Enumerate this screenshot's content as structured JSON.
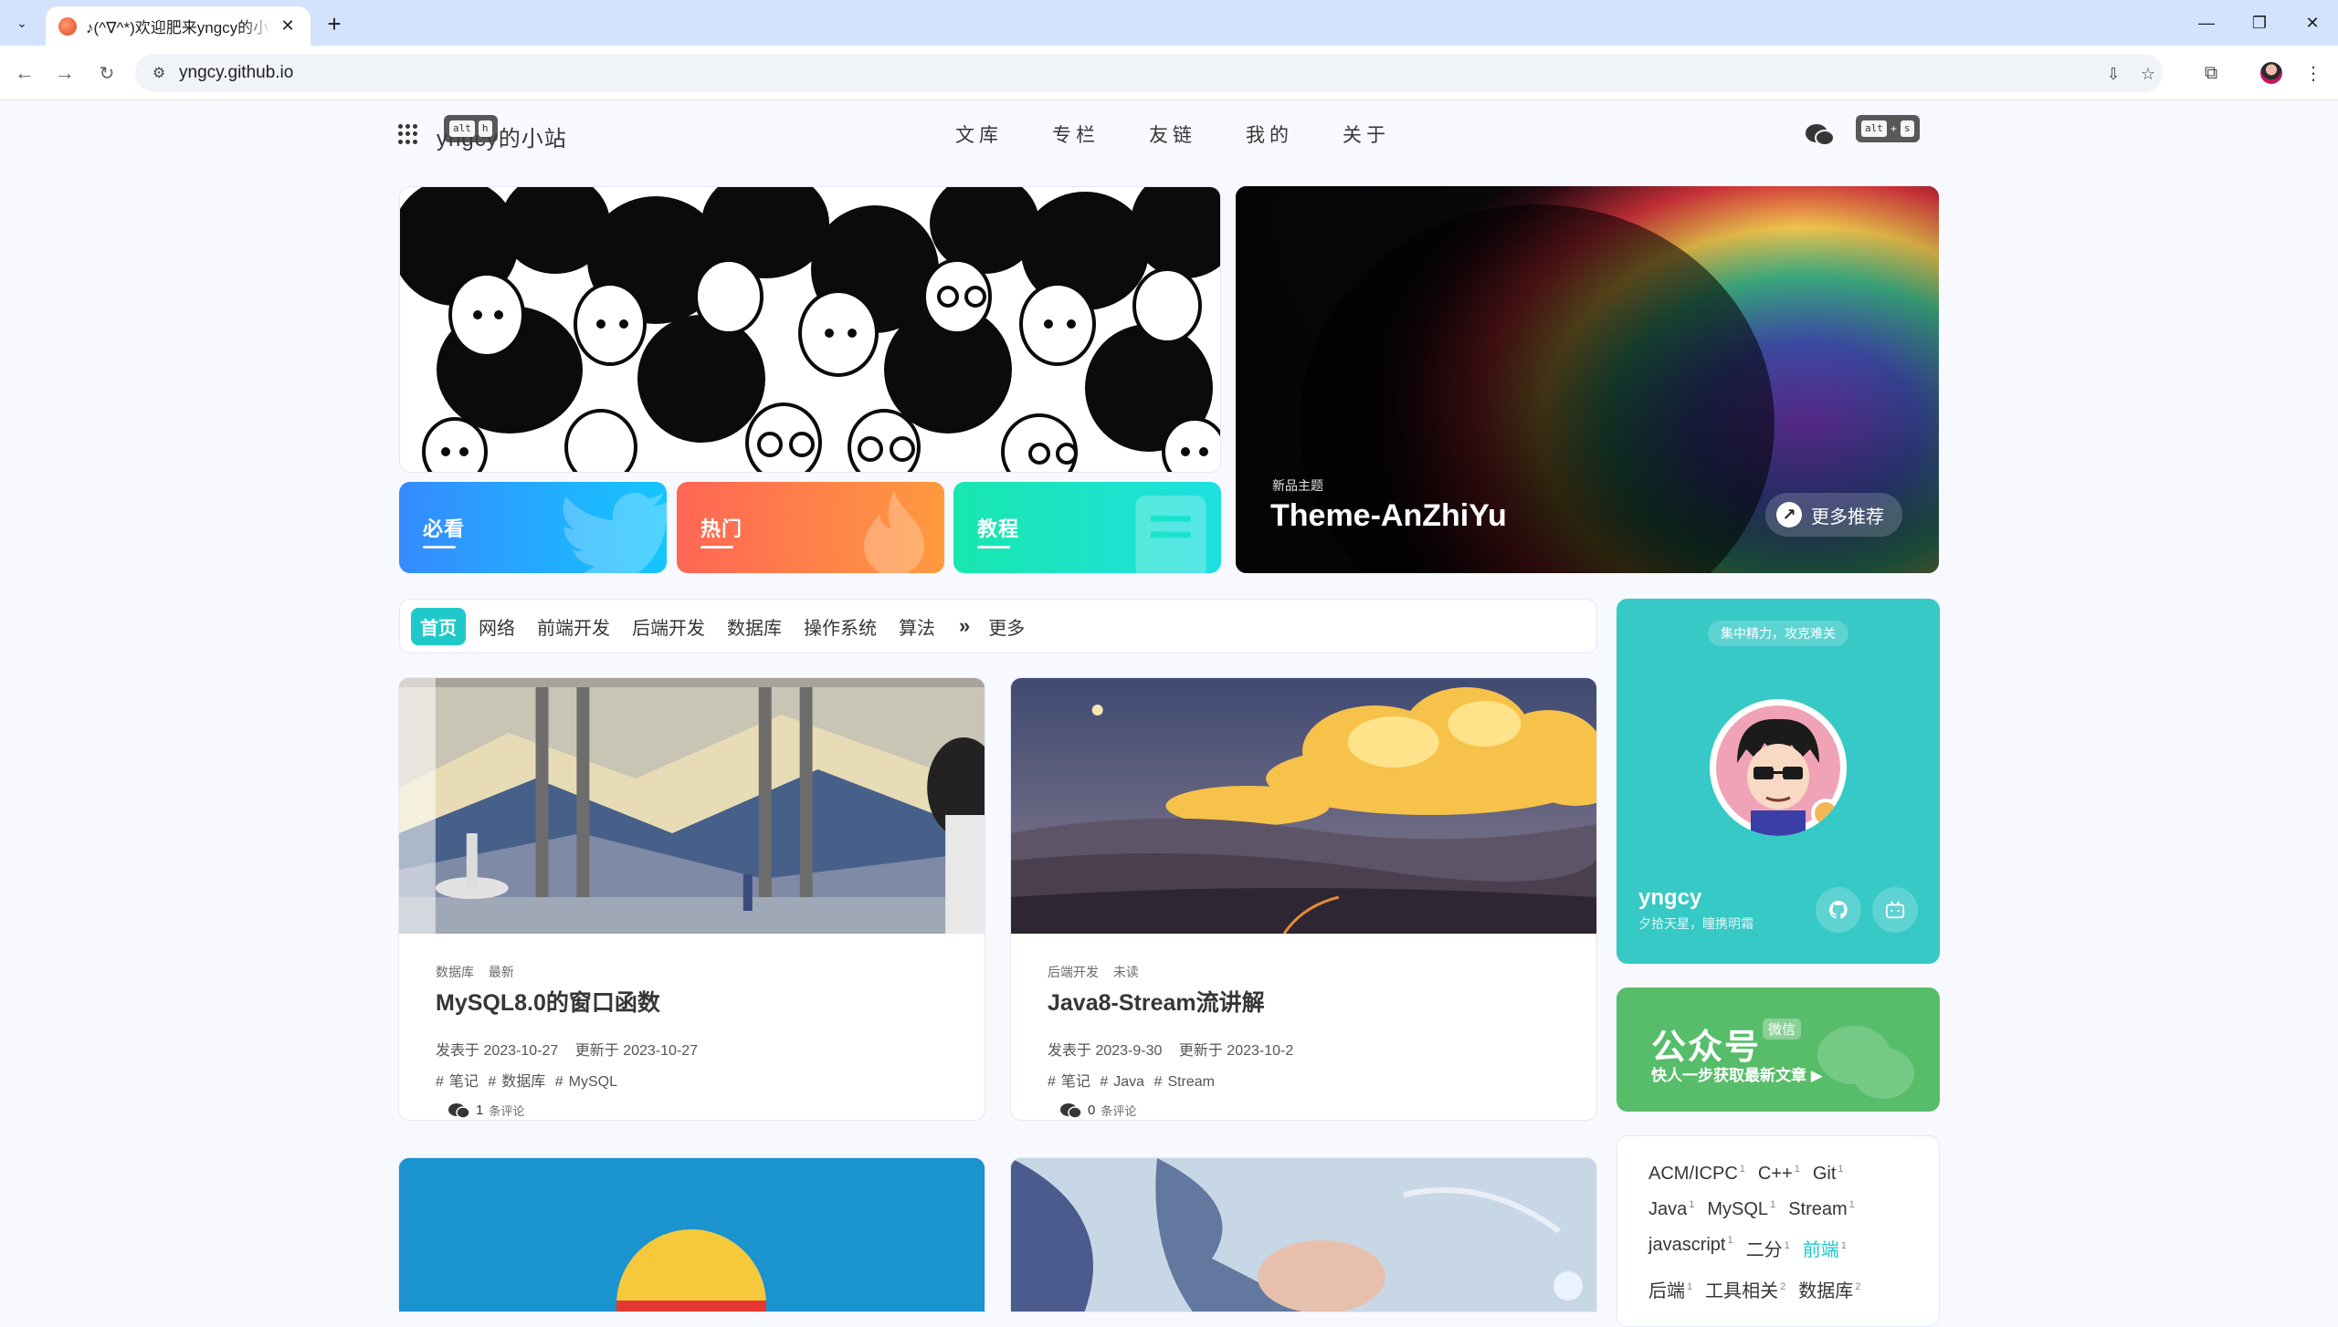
{
  "browser": {
    "tab_title": "♪(^∇^*)欢迎肥来yngcy的小站",
    "url": "yngcy.github.io"
  },
  "header": {
    "site_name": "yngcy的小站",
    "kbd_hint_left": [
      "alt",
      "h"
    ],
    "kbd_hint_right": [
      "alt",
      "+",
      "s"
    ],
    "nav": [
      "文库",
      "专栏",
      "友链",
      "我的",
      "关于"
    ]
  },
  "hero": {
    "categories": [
      {
        "label": "必看",
        "color_from": "#358bff",
        "color_to": "#15c6ff"
      },
      {
        "label": "热门",
        "color_from": "#f65",
        "color_to": "#ff9a3e"
      },
      {
        "label": "教程",
        "color_from": "#18e7ae",
        "color_to": "#1ee0e1"
      }
    ],
    "featured_tag": "新品主题",
    "featured_title": "Theme-AnZhiYu",
    "more_label": "更多推荐"
  },
  "category_bar": {
    "items": [
      "首页",
      "网络",
      "前端开发",
      "后端开发",
      "数据库",
      "操作系统",
      "算法"
    ],
    "active_index": 0,
    "more_label": "更多"
  },
  "posts": [
    {
      "categories": [
        "数据库",
        "最新"
      ],
      "title": "MySQL8.0的窗口函数",
      "published": "发表于 2023-10-27",
      "updated": "更新于 2023-10-27",
      "tags": [
        "笔记",
        "数据库",
        "MySQL"
      ],
      "comment_count": "1",
      "comment_suffix": "条评论"
    },
    {
      "categories": [
        "后端开发",
        "未读"
      ],
      "title": "Java8-Stream流讲解",
      "published": "发表于 2023-9-30",
      "updated": "更新于 2023-10-2",
      "tags": [
        "笔记",
        "Java",
        "Stream"
      ],
      "comment_count": "0",
      "comment_suffix": "条评论"
    }
  ],
  "sidebar": {
    "motto": "集中精力，攻克难关",
    "author_name": "yngcy",
    "author_sub": "夕拾天星，瞳携明霜",
    "wechat_title": "公众号",
    "wechat_badge": "微信",
    "wechat_sub": "快人一步获取最新文章 ▶",
    "tags": [
      [
        {
          "name": "ACM/ICPC",
          "count": "1"
        },
        {
          "name": "C++",
          "count": "1"
        },
        {
          "name": "Git",
          "count": "1"
        }
      ],
      [
        {
          "name": "Java",
          "count": "1"
        },
        {
          "name": "MySQL",
          "count": "1"
        },
        {
          "name": "Stream",
          "count": "1"
        }
      ],
      [
        {
          "name": "javascript",
          "count": "1"
        },
        {
          "name": "二分",
          "count": "1"
        },
        {
          "name": "前端",
          "count": "1",
          "highlight": true
        }
      ],
      [
        {
          "name": "后端",
          "count": "1"
        },
        {
          "name": "工具相关",
          "count": "2"
        },
        {
          "name": "数据库",
          "count": "2"
        }
      ]
    ]
  },
  "colors": {
    "accent": "#1fc9c9",
    "author_card": "#36c9c6",
    "wechat_card": "#57bd6a",
    "browser_tabbar": "#d3e3fd"
  }
}
